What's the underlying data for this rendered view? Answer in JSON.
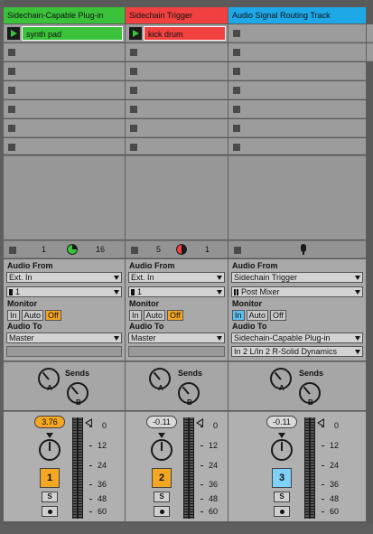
{
  "tracks": [
    {
      "name": "Sidechain-Capable Plug-in",
      "color": "#3bc23b",
      "clip": "synth pad",
      "clip_color": "#3bc23b",
      "status_a": "1",
      "status_b": "16",
      "audio_from_label": "Audio From",
      "audio_from": "Ext. In",
      "audio_from_ch": "1",
      "monitor_label": "Monitor",
      "monitor": [
        "In",
        "Auto",
        "Off"
      ],
      "audio_to_label": "Audio To",
      "audio_to": "Master",
      "sends_label": "Sends",
      "send_a": "A",
      "send_b": "B",
      "pan": "3.76",
      "track_num": "1",
      "solo": "S",
      "scale": [
        "0",
        "12",
        "24",
        "36",
        "48",
        "60"
      ]
    },
    {
      "name": "Sidechain Trigger",
      "color": "#f04040",
      "clip": "kick drum",
      "clip_color": "#f04040",
      "status_a": "5",
      "status_b": "1",
      "audio_from_label": "Audio From",
      "audio_from": "Ext. In",
      "audio_from_ch": "1",
      "monitor_label": "Monitor",
      "monitor": [
        "In",
        "Auto",
        "Off"
      ],
      "audio_to_label": "Audio To",
      "audio_to": "Master",
      "sends_label": "Sends",
      "send_a": "A",
      "send_b": "B",
      "pan": "-0.11",
      "track_num": "2",
      "solo": "S",
      "scale": [
        "0",
        "12",
        "24",
        "36",
        "48",
        "60"
      ]
    },
    {
      "name": "Audio Signal Routing Track",
      "color": "#1ea8e8",
      "audio_from_label": "Audio From",
      "audio_from": "Sidechain Trigger",
      "audio_from_ch": "Post Mixer",
      "monitor_label": "Monitor",
      "monitor": [
        "In",
        "Auto",
        "Off"
      ],
      "audio_to_label": "Audio To",
      "audio_to": "Sidechain-Capable Plug-in",
      "audio_to_ch": "In 2 L/In 2 R-Solid Dynamics",
      "sends_label": "Sends",
      "send_a": "A",
      "send_b": "B",
      "pan": "-0.11",
      "track_num": "3",
      "solo": "S",
      "scale": [
        "0",
        "12",
        "24",
        "36",
        "48",
        "60"
      ]
    }
  ],
  "colors": {
    "orange": "#f5a623",
    "blue": "#5cc0f0"
  }
}
